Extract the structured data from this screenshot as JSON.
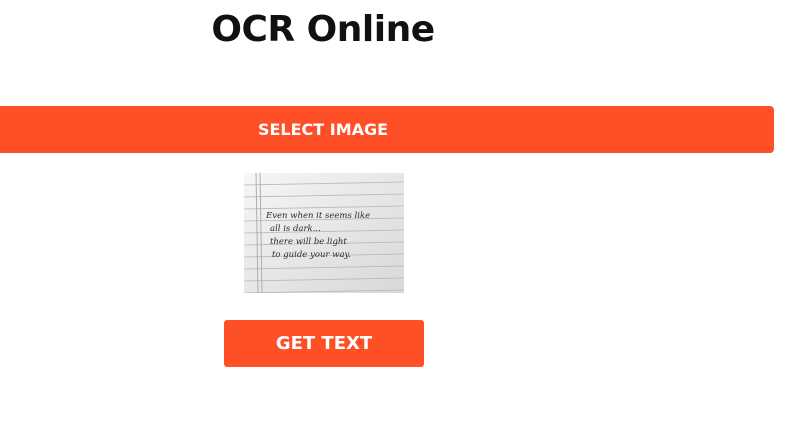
{
  "header": {
    "title": "OCR Online"
  },
  "actions": {
    "select_image_label": "SELECT IMAGE",
    "get_text_label": "GET TEXT"
  },
  "preview": {
    "lines": [
      "Even when it seems like",
      "all is dark...",
      "there will be light",
      "to guide your way."
    ]
  },
  "colors": {
    "accent": "#ff4f27",
    "text": "#111111",
    "background": "#ffffff"
  }
}
